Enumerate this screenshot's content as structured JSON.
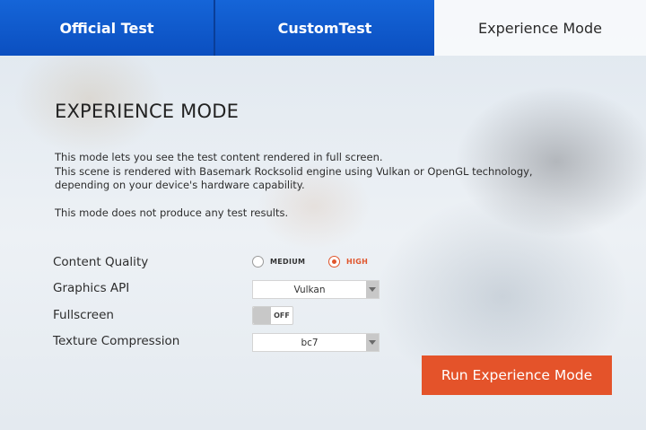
{
  "tabs": [
    {
      "label": "Official Test",
      "active": false
    },
    {
      "label": "CustomTest",
      "active": false
    },
    {
      "label": "Experience Mode",
      "active": true
    }
  ],
  "page": {
    "title": "EXPERIENCE MODE",
    "description": [
      "This mode lets you see the test content rendered in full screen.",
      "This scene is rendered with Basemark Rocksolid engine using Vulkan or OpenGL technology,",
      "depending on your device's hardware capability."
    ],
    "note": "This mode does not produce any test results."
  },
  "settings": {
    "content_quality": {
      "label": "Content Quality",
      "options": [
        "MEDIUM",
        "HIGH"
      ],
      "selected": "HIGH"
    },
    "graphics_api": {
      "label": "Graphics API",
      "value": "Vulkan"
    },
    "fullscreen": {
      "label": "Fullscreen",
      "state": "OFF"
    },
    "texture_compression": {
      "label": "Texture Compression",
      "value": "bc7"
    }
  },
  "actions": {
    "run_label": "Run Experience Mode"
  },
  "colors": {
    "accent": "#e4532a",
    "tab_blue": "#1565d8"
  },
  "icons": {
    "dropdown": "chevron-down-icon"
  }
}
